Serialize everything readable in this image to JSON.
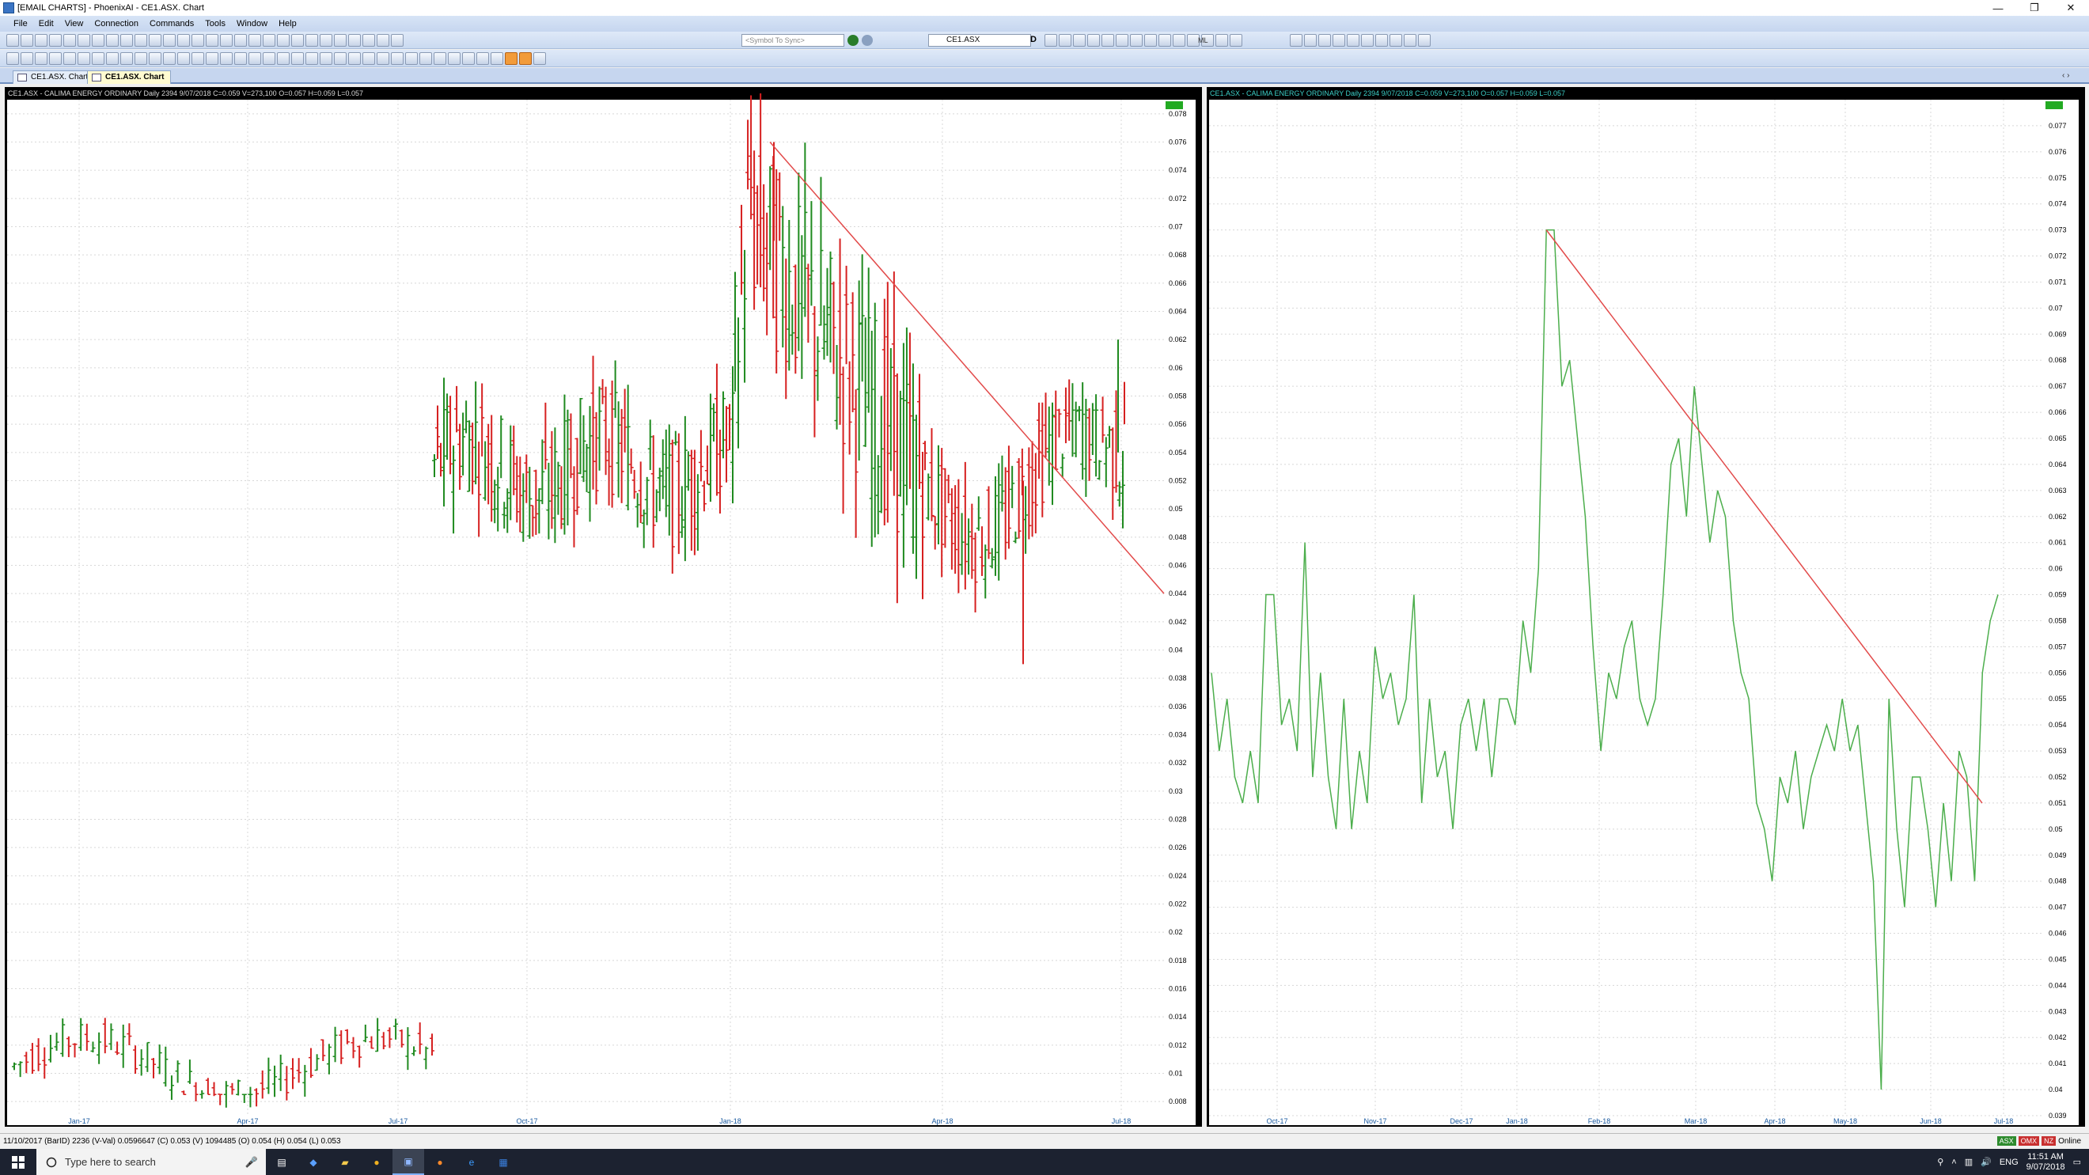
{
  "window": {
    "title": "[EMAIL CHARTS] - PhoenixAI - CE1.ASX. Chart",
    "controls": [
      "—",
      "❐",
      "✕"
    ]
  },
  "menu": [
    "File",
    "Edit",
    "View",
    "Connection",
    "Commands",
    "Tools",
    "Window",
    "Help"
  ],
  "toolbar": {
    "sync_placeholder": "<Symbol To Sync>",
    "symbol": "CE1.ASX",
    "period": "D",
    "ml_label": "ML"
  },
  "tabs": [
    {
      "label": "CE1.ASX. Chart",
      "active": false
    },
    {
      "label": "CE1.ASX. Chart",
      "active": true
    }
  ],
  "tab_nav": "‹ ›",
  "colors": {
    "up": "#1f8a1f",
    "down": "#d62020",
    "line": "#4cae4c",
    "trend": "#e24a4a",
    "header_text": "#d9d9d9",
    "header_text_right": "#3cd0c8",
    "axis_text": "#000000"
  },
  "left_chart": {
    "header": "CE1.ASX  -  CALIMA ENERGY ORDINARY Daily 2394 9/07/2018 C=0.059 V=273,100 O=0.057 H=0.059 L=0.057",
    "y_ticks": [
      "0.078",
      "0.076",
      "0.074",
      "0.072",
      "0.07",
      "0.068",
      "0.066",
      "0.064",
      "0.062",
      "0.06",
      "0.058",
      "0.056",
      "0.054",
      "0.052",
      "0.05",
      "0.048",
      "0.046",
      "0.044",
      "0.042",
      "0.04",
      "0.038",
      "0.036",
      "0.034",
      "0.032",
      "0.03",
      "0.028",
      "0.026",
      "0.024",
      "0.022",
      "0.02",
      "0.018",
      "0.016",
      "0.014",
      "0.012",
      "0.01",
      "0.008"
    ],
    "x_ticks": [
      "Jan-17",
      "Apr-17",
      "Jul-17",
      "Oct-17",
      "Jan-18",
      "Apr-18",
      "Jul-18"
    ]
  },
  "right_chart": {
    "header": "CE1.ASX  -  CALIMA ENERGY ORDINARY Daily 2394 9/07/2018 C=0.059 V=273,100 O=0.057 H=0.059 L=0.057",
    "y_ticks": [
      "0.077",
      "0.076",
      "0.075",
      "0.074",
      "0.073",
      "0.072",
      "0.071",
      "0.07",
      "0.069",
      "0.068",
      "0.067",
      "0.066",
      "0.065",
      "0.064",
      "0.063",
      "0.062",
      "0.061",
      "0.06",
      "0.059",
      "0.058",
      "0.057",
      "0.056",
      "0.055",
      "0.054",
      "0.053",
      "0.052",
      "0.051",
      "0.05",
      "0.049",
      "0.048",
      "0.047",
      "0.046",
      "0.045",
      "0.044",
      "0.043",
      "0.042",
      "0.041",
      "0.04",
      "0.039"
    ],
    "x_ticks": [
      "Oct-17",
      "Nov-17",
      "Dec-17",
      "Jan-18",
      "Feb-18",
      "Mar-18",
      "Apr-18",
      "May-18",
      "Jun-18",
      "Jul-18"
    ]
  },
  "chart_data": [
    {
      "type": "ohlc",
      "ylim": [
        0.007,
        0.079
      ],
      "x_ticks": [
        "Jan-17",
        "Apr-17",
        "Jul-17",
        "Oct-17",
        "Jan-18",
        "Apr-18",
        "Jul-18"
      ],
      "note_series": "daily OHLC bars",
      "segments": [
        {
          "x_range": [
            "Jan-17",
            "Jul-17"
          ],
          "approx_range": [
            0.008,
            0.014
          ]
        },
        {
          "x_range": [
            "Jul-17",
            "Jan-18"
          ],
          "approx_range": [
            0.043,
            0.062
          ]
        },
        {
          "x_range": [
            "Jan-18",
            "Apr-18"
          ],
          "approx_range": [
            0.046,
            0.076
          ]
        },
        {
          "x_range": [
            "Apr-18",
            "Jul-18"
          ],
          "approx_range": [
            0.039,
            0.062
          ]
        }
      ],
      "last": {
        "date": "9/07/2018",
        "open": 0.057,
        "high": 0.059,
        "low": 0.057,
        "close": 0.059,
        "volume": 273100
      },
      "trendline": {
        "from": [
          0.076,
          "Jan-18"
        ],
        "to": [
          0.044,
          "Jul-18"
        ]
      }
    },
    {
      "type": "line",
      "ylim": [
        0.039,
        0.078
      ],
      "x_ticks": [
        "Oct-17",
        "Nov-17",
        "Dec-17",
        "Jan-18",
        "Feb-18",
        "Mar-18",
        "Apr-18",
        "May-18",
        "Jun-18",
        "Jul-18"
      ],
      "y": [
        0.056,
        0.053,
        0.055,
        0.052,
        0.051,
        0.053,
        0.051,
        0.059,
        0.059,
        0.054,
        0.055,
        0.053,
        0.061,
        0.052,
        0.056,
        0.052,
        0.05,
        0.055,
        0.05,
        0.053,
        0.051,
        0.057,
        0.055,
        0.056,
        0.054,
        0.055,
        0.059,
        0.051,
        0.055,
        0.052,
        0.053,
        0.05,
        0.054,
        0.055,
        0.053,
        0.055,
        0.052,
        0.055,
        0.055,
        0.054,
        0.058,
        0.056,
        0.06,
        0.073,
        0.073,
        0.067,
        0.068,
        0.065,
        0.062,
        0.057,
        0.053,
        0.056,
        0.055,
        0.057,
        0.058,
        0.055,
        0.054,
        0.055,
        0.059,
        0.064,
        0.065,
        0.062,
        0.067,
        0.064,
        0.061,
        0.063,
        0.062,
        0.058,
        0.056,
        0.055,
        0.051,
        0.05,
        0.048,
        0.052,
        0.051,
        0.053,
        0.05,
        0.052,
        0.053,
        0.054,
        0.053,
        0.055,
        0.053,
        0.054,
        0.051,
        0.048,
        0.04,
        0.055,
        0.05,
        0.047,
        0.052,
        0.052,
        0.05,
        0.047,
        0.051,
        0.048,
        0.053,
        0.052,
        0.048,
        0.056,
        0.058,
        0.059
      ],
      "trendline": {
        "from": [
          0.073,
          "Feb-18"
        ],
        "to": [
          0.051,
          "Jul-18"
        ]
      },
      "last": {
        "date": "9/07/2018",
        "close": 0.059
      }
    }
  ],
  "status": {
    "text": "11/10/2017 (BarID) 2236 (V-Val) 0.0596647 (C) 0.053 (V) 1094485 (O) 0.054 (H) 0.054 (L) 0.053",
    "badges": [
      "ASX",
      "OMX",
      "NZ"
    ],
    "online": "Online"
  },
  "taskbar": {
    "search_placeholder": "Type here to search",
    "lang": "ENG",
    "time": "11:51 AM",
    "date": "9/07/2018"
  }
}
